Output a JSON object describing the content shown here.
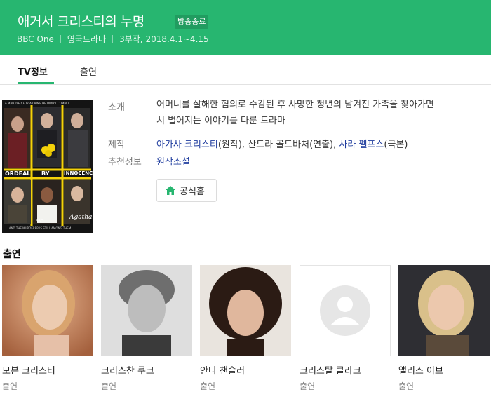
{
  "header": {
    "title": "애거서 크리스티의 누명",
    "badge": "방송종료",
    "channel": "BBC One",
    "genre": "영국드라마",
    "episodes_dates": "3부작, 2018.4.1~4.15"
  },
  "tabs": [
    {
      "label": "TV정보",
      "active": true
    },
    {
      "label": "출연",
      "active": false
    }
  ],
  "poster": {
    "tagline": "A MAN DIED FOR A CRIME HE DIDN'T COMMIT...",
    "words": [
      "ORDEAL",
      "BY",
      "INNOCENCE"
    ],
    "signature": "Agatha Christie",
    "bottom_line": "...AND THE MURDERER IS STILL AMONG THEM",
    "network": "BBC"
  },
  "info": {
    "intro_label": "소개",
    "intro_text": "어머니를 살해한 혐의로 수감된 후 사망한 청년의 남겨진 가족을 찾아가면서 벌어지는 이야기를 다룬 드라마",
    "production_label": "제작",
    "production": {
      "writer_name": "아가사 크리스티",
      "writer_role": "(원작), ",
      "director_name": "산드라 골드바처",
      "director_role": "(연출), ",
      "screenwriter_name": "사라 펠프스",
      "screenwriter_role": "(극본)"
    },
    "recommend_label": "추천정보",
    "recommend_value": "원작소설",
    "homepage_button": "공식홈"
  },
  "cast_heading": "출연",
  "cast": [
    {
      "name": "모븐 크리스티",
      "role": "출연"
    },
    {
      "name": "크리스찬 쿠크",
      "role": "출연"
    },
    {
      "name": "안나 챈슬러",
      "role": "출연"
    },
    {
      "name": "크리스탈 클라크",
      "role": "출연"
    },
    {
      "name": "앨리스 이브",
      "role": "출연"
    }
  ],
  "colors": {
    "brand_green": "#27b670",
    "link_blue": "#1f3c9e",
    "poster_yellow": "#f4d20a"
  }
}
